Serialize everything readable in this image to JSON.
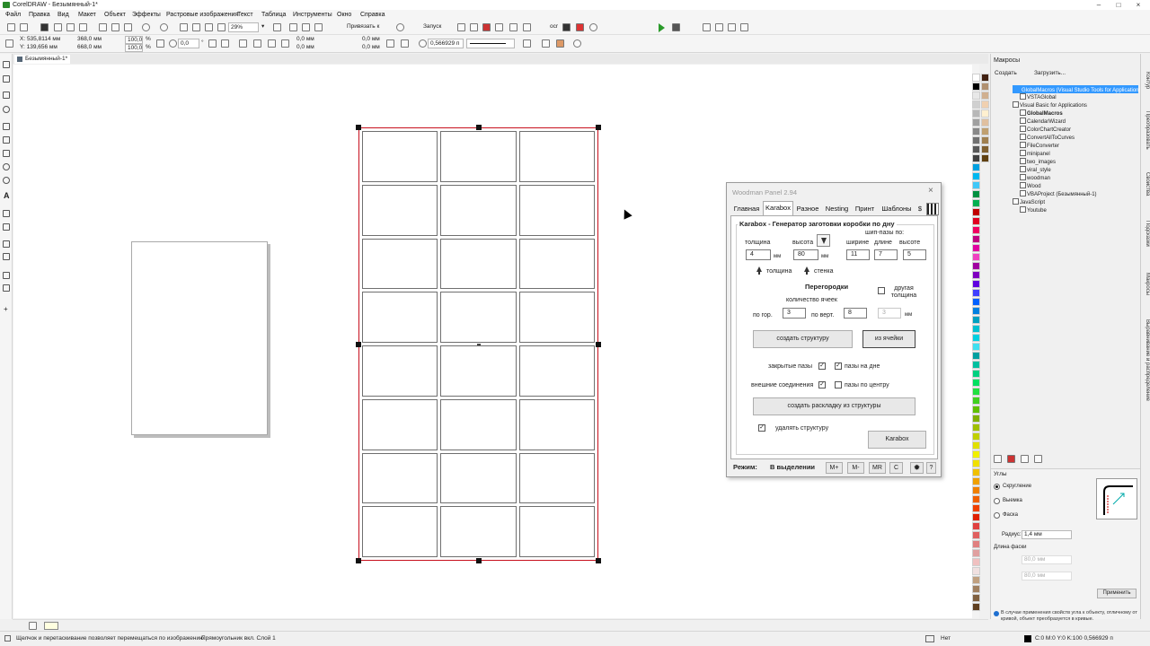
{
  "window": {
    "title": "CorelDRAW - Безымянный-1*",
    "controls": [
      "–",
      "□",
      "×"
    ]
  },
  "menu": [
    "Файл",
    "Правка",
    "Вид",
    "Макет",
    "Объект",
    "Эффекты",
    "Растровые изображения",
    "Текст",
    "Таблица",
    "Инструменты",
    "Окно",
    "Справка"
  ],
  "toolbar1": {
    "zoom": "29%",
    "zoom_arrow": "▾",
    "launch_label": "Запуск",
    "snap_label": "Привязать к",
    "ocr_label": "ocr"
  },
  "toolbar2": {
    "x": "X: 535,8114 мм",
    "y": "Y: 139,656 мм",
    "w": "368,0 мм",
    "h": "668,0 мм",
    "sx": "100,0",
    "sy": "100,0",
    "pct": "%",
    "angle": "0,0",
    "deg": "°",
    "c1": "0,0 мм",
    "c2": "0,0 мм",
    "c3": "0,0 мм",
    "c4": "0,0 мм",
    "outline": "0,566929 п"
  },
  "doc_tab": "Безымянный-1*",
  "palette": [
    "#ffffff",
    "#000000",
    "#e8e8e8",
    "#d0d0d0",
    "#b8b8b8",
    "#a0a0a0",
    "#888888",
    "#707070",
    "#585858",
    "#404040",
    "#00a0e0",
    "#00b8f0",
    "#40c8f8",
    "#009040",
    "#00b050",
    "#c00000",
    "#e00020",
    "#f00060",
    "#c00080",
    "#e000a0",
    "#f040c0",
    "#a000a0",
    "#8000c0",
    "#6000e0",
    "#4040ff",
    "#0060ff",
    "#0080e0",
    "#00a0c0",
    "#00c0d0",
    "#00d0e0",
    "#40e0f0",
    "#00a0a0",
    "#00c0a0",
    "#00d080",
    "#00e060",
    "#20e040",
    "#40d020",
    "#60c000",
    "#80b000",
    "#a0c000",
    "#c0d000",
    "#e0e000",
    "#f0f000",
    "#f0e000",
    "#f0c000",
    "#f0a000",
    "#f08000",
    "#f06000",
    "#f04000",
    "#e02000",
    "#e04040",
    "#e06060",
    "#e08080",
    "#e0a0a0",
    "#f0c0c0",
    "#f0e0e0",
    "#c0a080",
    "#a08060",
    "#806040",
    "#604020",
    "#402010",
    "#b09070",
    "#d0b090",
    "#f0d0b0",
    "#fff0d0",
    "#e0c0a0",
    "#c0a070",
    "#a08050",
    "#806030",
    "#604010"
  ],
  "docker": {
    "title": "Макросы",
    "create": "Создать",
    "load": "Загрузить...",
    "tree_top": "GlobalMacros (Visual Studio Tools for Applications)",
    "items": [
      "VSTAGlobal",
      "Visual Basic for Applications",
      "GlobalMacros",
      "CalendarWizard",
      "ColorChartCreator",
      "ConvertAllToCurves",
      "FileConverter",
      "minipanel",
      "two_images",
      "viral_style",
      "woodman",
      "Wood",
      "VBAProject (Безымянный-1)",
      "JavaScript",
      "Youtube"
    ]
  },
  "corners": {
    "title": "Углы",
    "round": "Скругление",
    "scallop": "Выемка",
    "chamfer": "Фаска",
    "radius_label": "Радиус:",
    "radius": "1,4 мм",
    "chamfer_len": "Длина фаски",
    "v1": "80,0 мм",
    "v2": "80,0 мм",
    "apply": "Применить",
    "info": "В случае применения свойств угла к объекту, отличному от кривой, объект преобразуется в кривые."
  },
  "side_tabs": [
    "Контур",
    "Преобразовать",
    "Свойства",
    "Подсказки",
    "Макросы",
    "Выравнивание и распределение"
  ],
  "status": {
    "hint": "Щелчок и перетаскивание позволяет перемещаться по изображению.",
    "layer": "Прямоугольник вкл. Слой 1",
    "fill": "Нет",
    "outline": "C:0 M:0 Y:0 K:100  0,566929 п"
  },
  "dialog": {
    "title": "Woodman Panel 2.94",
    "close": "×",
    "tabs": [
      "Главная",
      "Karabox",
      "Разное",
      "Nesting",
      "Принт",
      "Шаблоны",
      "$"
    ],
    "group_title": "Karabox - Генератор заготовки коробки по дну",
    "thickness_label": "толщина",
    "height_label": "высота",
    "unit": "мм",
    "thickness": "4",
    "height": "80",
    "tenon_label": "шип-пазы по:",
    "width_label": "ширине",
    "length_label": "длине",
    "height2_label": "высоте",
    "t_width": "11",
    "t_length": "7",
    "t_height": "5",
    "up_thickness": "толщина",
    "up_wall": "стенка",
    "partitions": "Перегородки",
    "other_thickness": "другая толщина",
    "cells_count": "количество ячеек",
    "horiz_label": "по гор.",
    "vert_label": "по верт.",
    "horiz": "3",
    "vert": "8",
    "other_val": "3",
    "btn_create": "создать структуру",
    "btn_cells": "из ячейки",
    "closed_slots": "закрытые пазы",
    "bottom_slots": "пазы на дне",
    "outer_joints": "внешние соединения",
    "center_slots": "пазы по центру",
    "btn_layout": "создать раскладку из структуры",
    "delete_struct": "удалять структуру",
    "btn_karabox": "Karabox",
    "check": "✓",
    "mode_label": "Режим:",
    "mode_value": "В выделении",
    "mplus": "M+",
    "mminus": "M-",
    "mr": "MR",
    "c": "C",
    "help": "?"
  }
}
